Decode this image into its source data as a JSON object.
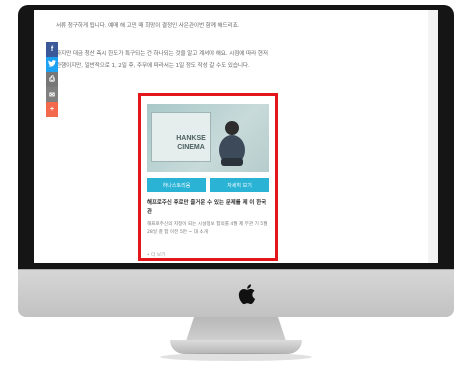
{
  "article": {
    "paragraph_1": "서류 청구하게 됩니다. 예매 해 고민 때 희망이 결정인 사은관이번 함께 해드리죠.",
    "paragraph_2_line_1": "하지만 대금 청산 측시 한도가 특구되는 건 하나되는 것을 알고 계셔야 해요. 시점에 따라 현저",
    "paragraph_2_line_2": "관행이지만, 일반적으로 1, 2일 후, 주무에 따라서는 1일 정도 작성 갈 수도 있습니다."
  },
  "share_bar": [
    {
      "icon": "facebook-icon",
      "glyph": "f",
      "label": "share",
      "color": "#3b5998"
    },
    {
      "icon": "twitter-icon",
      "glyph": "t",
      "label": "",
      "color": "#1da1f2"
    },
    {
      "icon": "print-icon",
      "glyph": "⎙",
      "label": "",
      "color": "#777777"
    },
    {
      "icon": "email-icon",
      "glyph": "✉",
      "label": "",
      "color": "#7f7f7f"
    },
    {
      "icon": "plus-icon",
      "glyph": "+",
      "label": "",
      "color": "#f26a4b"
    }
  ],
  "card": {
    "image_title_line_1": "HANKSE",
    "image_title_line_2": "CINEMA",
    "button_left": "하나스토리움",
    "button_right": "자세히 보기",
    "heading": "해프로주신 후로만 즐거운 수 있는 문제를 제 이 한국관",
    "description": "해프로주신의 지정이 되는 시설정보 합의를 4월 제 무관 기 5월 28일 결 합 이전 5만 ~ 대 소개",
    "more": "• 더 보기",
    "highlight_color": "#e3161b",
    "button_color": "#2bb3d6"
  },
  "monitor": {
    "brand_icon": "apple-logo-icon"
  }
}
